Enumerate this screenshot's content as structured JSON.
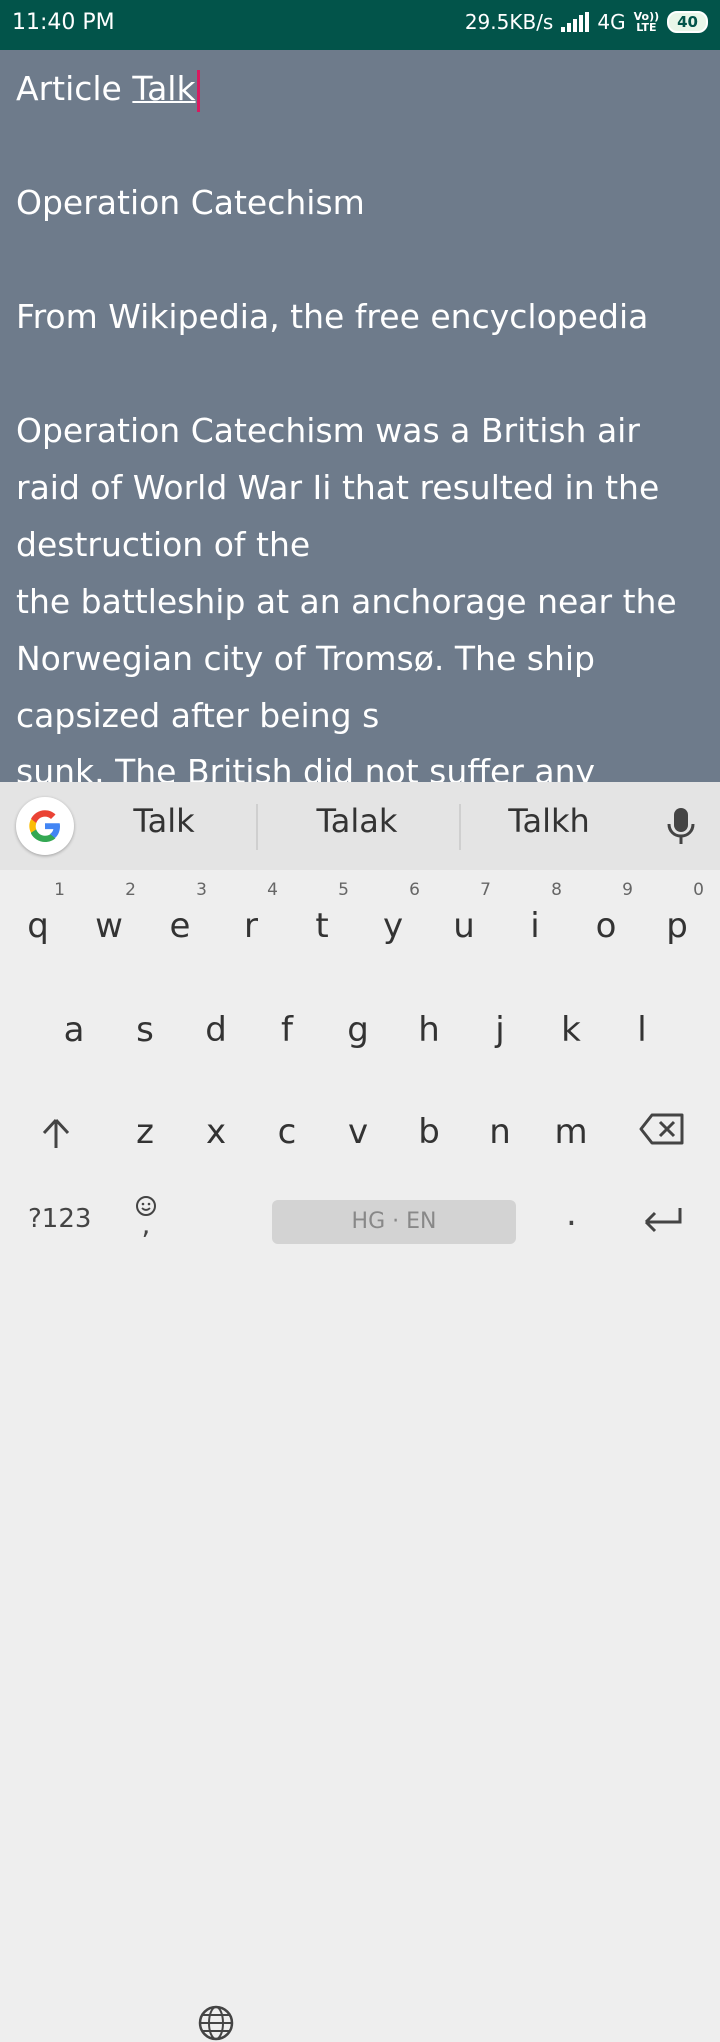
{
  "status": {
    "time": "11:40 PM",
    "speed": "29.5KB/s",
    "network": "4G",
    "volte_top": "Vo))",
    "volte_bottom": "LTE",
    "battery": "40"
  },
  "editor": {
    "title_word": "Article",
    "title_underlined": "Talk",
    "heading": "Operation Catechism",
    "from_line": "From Wikipedia, the free encyclopedia",
    "body_lines": [
      "Operation Catechism was a British air",
      "raid of World War Ii that resulted in the",
      "destruction of the",
      "the battleship at an anchorage near the",
      "Norwegian city of Tromsø. The ship",
      "capsized after being s"
    ],
    "cut_line": "sunk. The British did not suffer any"
  },
  "keyboard": {
    "suggestions": [
      "Talk",
      "Talak",
      "Talkh"
    ],
    "row1": [
      {
        "ch": "q",
        "hint": "1"
      },
      {
        "ch": "w",
        "hint": "2"
      },
      {
        "ch": "e",
        "hint": "3"
      },
      {
        "ch": "r",
        "hint": "4"
      },
      {
        "ch": "t",
        "hint": "5"
      },
      {
        "ch": "y",
        "hint": "6"
      },
      {
        "ch": "u",
        "hint": "7"
      },
      {
        "ch": "i",
        "hint": "8"
      },
      {
        "ch": "o",
        "hint": "9"
      },
      {
        "ch": "p",
        "hint": "0"
      }
    ],
    "row2": [
      "a",
      "s",
      "d",
      "f",
      "g",
      "h",
      "j",
      "k",
      "l"
    ],
    "row3": [
      "z",
      "x",
      "c",
      "v",
      "b",
      "n",
      "m"
    ],
    "symbols_label": "?123",
    "space_label": "HG · EN",
    "period_label": ".",
    "comma_label": ","
  }
}
